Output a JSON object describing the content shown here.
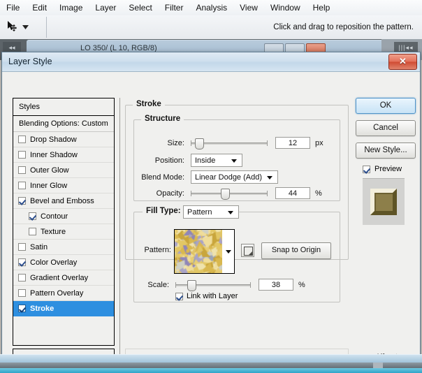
{
  "app": {
    "menu": [
      "File",
      "Edit",
      "Image",
      "Layer",
      "Select",
      "Filter",
      "Analysis",
      "View",
      "Window",
      "Help"
    ],
    "tool_icon": "move-tool-icon",
    "tool_preset_arrow": "chevron-down-icon",
    "options_hint": "Click and drag to reposition the pattern.",
    "document_title": "LO 350/ (L      10, RGB/8)"
  },
  "dialog": {
    "title": "Layer Style",
    "close_label": "✕",
    "watermark": "Alfoart.com"
  },
  "styles_panel": {
    "header": "Styles",
    "blending_options": "Blending Options: Custom",
    "items": [
      {
        "label": "Drop Shadow",
        "checked": false,
        "indent": false,
        "selected": false
      },
      {
        "label": "Inner Shadow",
        "checked": false,
        "indent": false,
        "selected": false
      },
      {
        "label": "Outer Glow",
        "checked": false,
        "indent": false,
        "selected": false
      },
      {
        "label": "Inner Glow",
        "checked": false,
        "indent": false,
        "selected": false
      },
      {
        "label": "Bevel and Emboss",
        "checked": true,
        "indent": false,
        "selected": false
      },
      {
        "label": "Contour",
        "checked": true,
        "indent": true,
        "selected": false
      },
      {
        "label": "Texture",
        "checked": false,
        "indent": true,
        "selected": false
      },
      {
        "label": "Satin",
        "checked": false,
        "indent": false,
        "selected": false
      },
      {
        "label": "Color Overlay",
        "checked": true,
        "indent": false,
        "selected": false
      },
      {
        "label": "Gradient Overlay",
        "checked": false,
        "indent": false,
        "selected": false
      },
      {
        "label": "Pattern Overlay",
        "checked": false,
        "indent": false,
        "selected": false
      },
      {
        "label": "Stroke",
        "checked": true,
        "indent": false,
        "selected": true
      }
    ]
  },
  "stroke": {
    "group_title": "Stroke",
    "structure": {
      "group_title": "Structure",
      "size_label": "Size:",
      "size_value": "12",
      "size_unit": "px",
      "size_percent": 10,
      "position_label": "Position:",
      "position_value": "Inside",
      "blend_mode_label": "Blend Mode:",
      "blend_mode_value": "Linear Dodge (Add)",
      "opacity_label": "Opacity:",
      "opacity_value": "44",
      "opacity_unit": "%",
      "opacity_percent": 44
    },
    "fill": {
      "group_title": "Fill Type:",
      "fill_type_value": "Pattern",
      "pattern_label": "Pattern:",
      "new_pattern_icon": "new-preset-icon",
      "snap_button": "Snap to Origin",
      "scale_label": "Scale:",
      "scale_value": "38",
      "scale_unit": "%",
      "scale_percent": 20,
      "link_label": "Link with Layer",
      "link_checked": true
    }
  },
  "buttons": {
    "ok": "OK",
    "cancel": "Cancel",
    "new_style": "New Style...",
    "preview_label": "Preview",
    "preview_checked": true
  },
  "colors": {
    "accent_selection": "#2e8fe0",
    "dialog_bg": "#f0f0ee",
    "titlebar": "#cfe0ee",
    "close_red": "#cf4b33",
    "pattern_gold": "#e0c469",
    "pattern_violet": "#8f86b8",
    "preview_olive": "#8d7f4a"
  }
}
